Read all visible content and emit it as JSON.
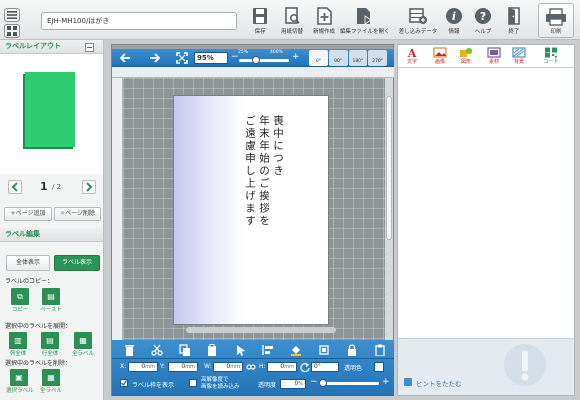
{
  "title_field": "EJH-MH100/はがき",
  "toolbar": [
    {
      "label": "保存",
      "icon": "save-icon"
    },
    {
      "label": "用紙切替",
      "icon": "paper-switch-icon"
    },
    {
      "label": "新規作成",
      "icon": "new-file-icon"
    },
    {
      "label": "編集ファイルを開く",
      "icon": "open-file-icon"
    },
    {
      "label": "差し込みデータ",
      "icon": "merge-data-icon"
    },
    {
      "label": "情報",
      "icon": "info-icon"
    },
    {
      "label": "ヘルプ",
      "icon": "help-icon"
    },
    {
      "label": "終了",
      "icon": "exit-icon"
    }
  ],
  "print_label": "印刷",
  "left": {
    "layout_header": "ラベルレイアウト",
    "page_current": "1",
    "page_total": "/ 2",
    "add_page": "ページ追加",
    "delete_page": "ページ削除",
    "edit_header": "ラベル編集",
    "view_all": "全体表示",
    "view_label": "ラベル表示",
    "copy_section": "ラベルのコピー：",
    "copy": "コピー",
    "paste": "ペースト",
    "expand_section": "選択中のラベルを展開：",
    "expand_items": [
      "列全体",
      "行全体",
      "全ラベル"
    ],
    "delete_section": "選択中のラベルを削除：",
    "delete_items": [
      "選択ラベル",
      "全ラベル"
    ],
    "colors": {
      "accent": "#2a9457",
      "thumbnail": "#2ecc6f"
    }
  },
  "editor": {
    "zoom": "95%",
    "zoom_min": "25%",
    "zoom_max": "400%",
    "zoom_level": 0.3,
    "rotations": [
      "0°",
      "90°",
      "180°",
      "270°"
    ],
    "card_text": [
      "喪中につき",
      "年末年始のご挨拶を",
      "ご遠慮申し上げます"
    ]
  },
  "props": {
    "x_label": "X:",
    "x_value": "0",
    "x_unit": "mm",
    "y_label": "Y:",
    "y_value": "0",
    "y_unit": "mm",
    "w_label": "W:",
    "w_value": "0",
    "w_unit": "mm",
    "h_label": "H:",
    "h_value": "0",
    "h_unit": "mm",
    "rotate_value": "0°",
    "transparent_label": "透明色",
    "show_frame": "ラベル枠を表示",
    "hires_line1": "高解像度で",
    "hires_line2": "画像を読み込み",
    "opacity_label": "透明度",
    "opacity_value": "0",
    "opacity_unit": "%"
  },
  "right_tabs": [
    "文字",
    "画像",
    "図形",
    "素材",
    "背景",
    "コード"
  ],
  "hint": "ヒントをたたむ"
}
